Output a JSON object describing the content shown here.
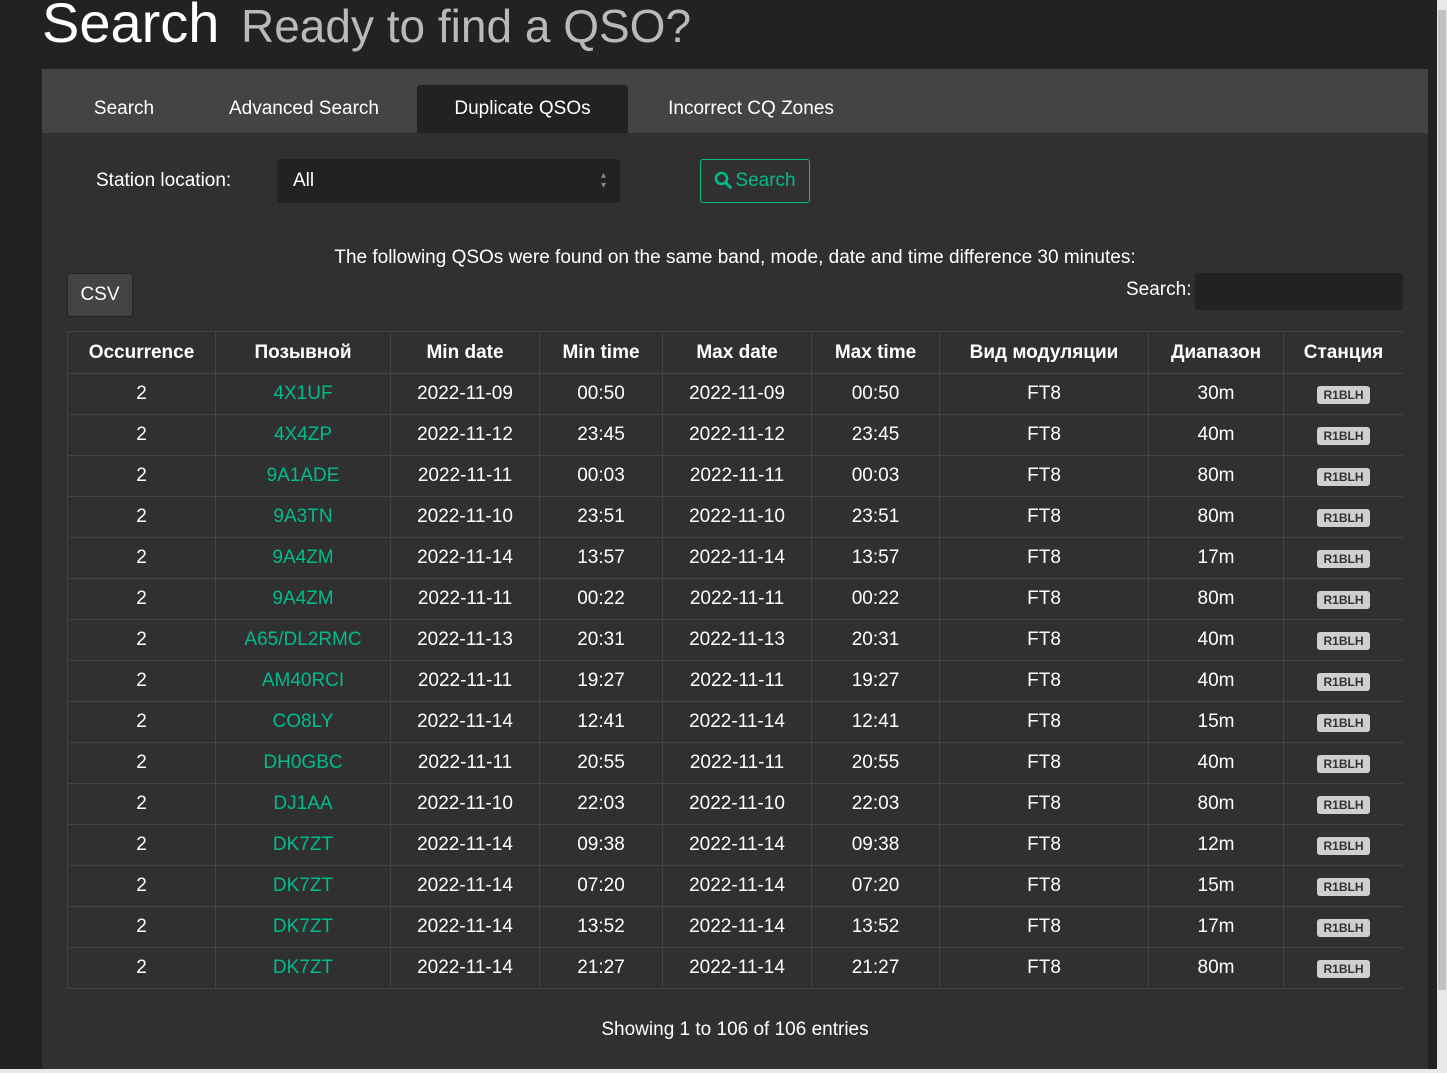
{
  "header": {
    "title": "Search",
    "subtitle": "Ready to find a QSO?"
  },
  "tabs": [
    {
      "label": "Search",
      "active": false
    },
    {
      "label": "Advanced Search",
      "active": false
    },
    {
      "label": "Duplicate QSOs",
      "active": true
    },
    {
      "label": "Incorrect CQ Zones",
      "active": false
    }
  ],
  "form": {
    "station_label": "Station location:",
    "station_value": "All",
    "search_button": "Search"
  },
  "notice": "The following QSOs were found on the same band, mode, date and time difference 30 minutes:",
  "csv_button": "CSV",
  "table_search_label": "Search:",
  "table_search_value": "",
  "columns": [
    "Occurrence",
    "Позывной",
    "Min date",
    "Min time",
    "Max date",
    "Max time",
    "Вид модуляции",
    "Диапазон",
    "Станция"
  ],
  "rows": [
    [
      "2",
      "4X1UF",
      "2022-11-09",
      "00:50",
      "2022-11-09",
      "00:50",
      "FT8",
      "30m",
      "R1BLH"
    ],
    [
      "2",
      "4X4ZP",
      "2022-11-12",
      "23:45",
      "2022-11-12",
      "23:45",
      "FT8",
      "40m",
      "R1BLH"
    ],
    [
      "2",
      "9A1ADE",
      "2022-11-11",
      "00:03",
      "2022-11-11",
      "00:03",
      "FT8",
      "80m",
      "R1BLH"
    ],
    [
      "2",
      "9A3TN",
      "2022-11-10",
      "23:51",
      "2022-11-10",
      "23:51",
      "FT8",
      "80m",
      "R1BLH"
    ],
    [
      "2",
      "9A4ZM",
      "2022-11-14",
      "13:57",
      "2022-11-14",
      "13:57",
      "FT8",
      "17m",
      "R1BLH"
    ],
    [
      "2",
      "9A4ZM",
      "2022-11-11",
      "00:22",
      "2022-11-11",
      "00:22",
      "FT8",
      "80m",
      "R1BLH"
    ],
    [
      "2",
      "A65/DL2RMC",
      "2022-11-13",
      "20:31",
      "2022-11-13",
      "20:31",
      "FT8",
      "40m",
      "R1BLH"
    ],
    [
      "2",
      "AM40RCI",
      "2022-11-11",
      "19:27",
      "2022-11-11",
      "19:27",
      "FT8",
      "40m",
      "R1BLH"
    ],
    [
      "2",
      "CO8LY",
      "2022-11-14",
      "12:41",
      "2022-11-14",
      "12:41",
      "FT8",
      "15m",
      "R1BLH"
    ],
    [
      "2",
      "DH0GBC",
      "2022-11-11",
      "20:55",
      "2022-11-11",
      "20:55",
      "FT8",
      "40m",
      "R1BLH"
    ],
    [
      "2",
      "DJ1AA",
      "2022-11-10",
      "22:03",
      "2022-11-10",
      "22:03",
      "FT8",
      "80m",
      "R1BLH"
    ],
    [
      "2",
      "DK7ZT",
      "2022-11-14",
      "09:38",
      "2022-11-14",
      "09:38",
      "FT8",
      "12m",
      "R1BLH"
    ],
    [
      "2",
      "DK7ZT",
      "2022-11-14",
      "07:20",
      "2022-11-14",
      "07:20",
      "FT8",
      "15m",
      "R1BLH"
    ],
    [
      "2",
      "DK7ZT",
      "2022-11-14",
      "13:52",
      "2022-11-14",
      "13:52",
      "FT8",
      "17m",
      "R1BLH"
    ],
    [
      "2",
      "DK7ZT",
      "2022-11-14",
      "21:27",
      "2022-11-14",
      "21:27",
      "FT8",
      "80m",
      "R1BLH"
    ]
  ],
  "info": "Showing 1 to 106 of 106 entries",
  "colors": {
    "accent": "#00bc8c",
    "background": "#222222",
    "card": "#303030",
    "tabbar": "#444444"
  }
}
